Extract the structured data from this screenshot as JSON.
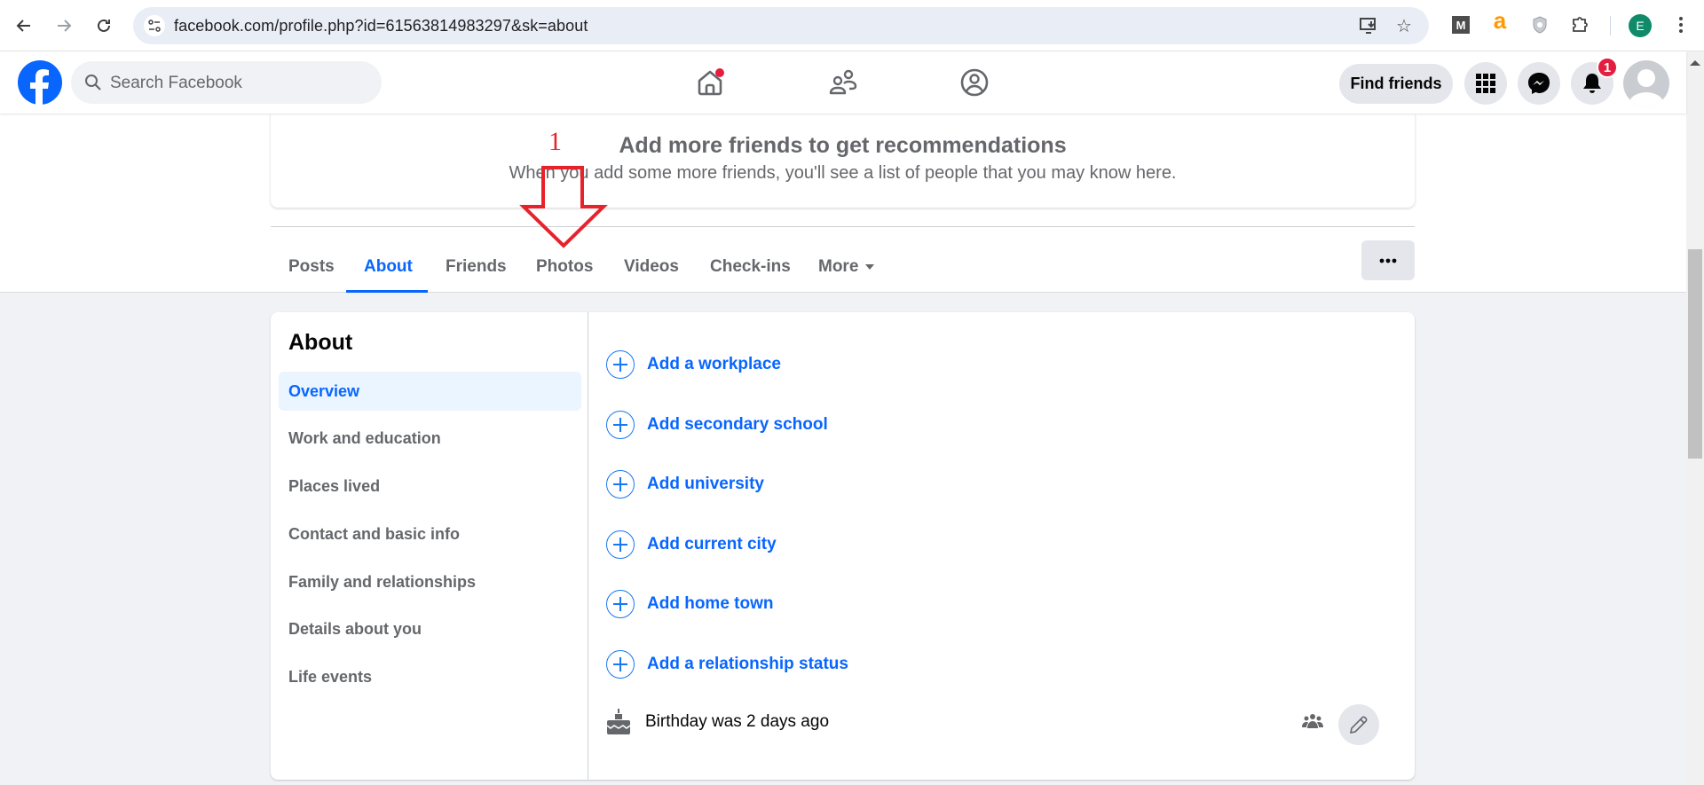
{
  "browser": {
    "url": "facebook.com/profile.php?id=61563814983297&sk=about",
    "profile_initial": "E",
    "icons": [
      "back-icon",
      "forward-icon",
      "reload-icon",
      "site-info-icon",
      "install-app-icon",
      "bookmark-star-icon",
      "m-extension-icon",
      "amazon-extension-icon",
      "shield-extension-icon",
      "extensions-puzzle-icon",
      "profile-avatar",
      "menu-kebab-icon"
    ],
    "colors": {
      "profile_avatar": "#0f8a6b",
      "amazon": "#ff9900"
    }
  },
  "header": {
    "search_placeholder": "Search Facebook",
    "find_friends": "Find friends",
    "notification_count": "1",
    "colors": {
      "brand": "#0866ff",
      "badge": "#e41e3f"
    }
  },
  "recommendations": {
    "title": "Add more friends to get recommendations",
    "subtitle": "When you add some more friends, you'll see a list of people that you may know here."
  },
  "tabs": [
    {
      "label": "Posts",
      "active": false
    },
    {
      "label": "About",
      "active": true
    },
    {
      "label": "Friends",
      "active": false
    },
    {
      "label": "Photos",
      "active": false
    },
    {
      "label": "Videos",
      "active": false
    },
    {
      "label": "Check-ins",
      "active": false
    },
    {
      "label": "More",
      "active": false
    }
  ],
  "more_options": "···",
  "about": {
    "title": "About",
    "sidebar": [
      {
        "label": "Overview",
        "active": true
      },
      {
        "label": "Work and education",
        "active": false
      },
      {
        "label": "Places lived",
        "active": false
      },
      {
        "label": "Contact and basic info",
        "active": false
      },
      {
        "label": "Family and relationships",
        "active": false
      },
      {
        "label": "Details about you",
        "active": false
      },
      {
        "label": "Life events",
        "active": false
      }
    ],
    "add_items": [
      "Add a workplace",
      "Add secondary school",
      "Add university",
      "Add current city",
      "Add home town",
      "Add a relationship status"
    ],
    "birthday": "Birthday was 2 days ago"
  },
  "annotation": {
    "label": "1",
    "color": "#e8222b"
  }
}
